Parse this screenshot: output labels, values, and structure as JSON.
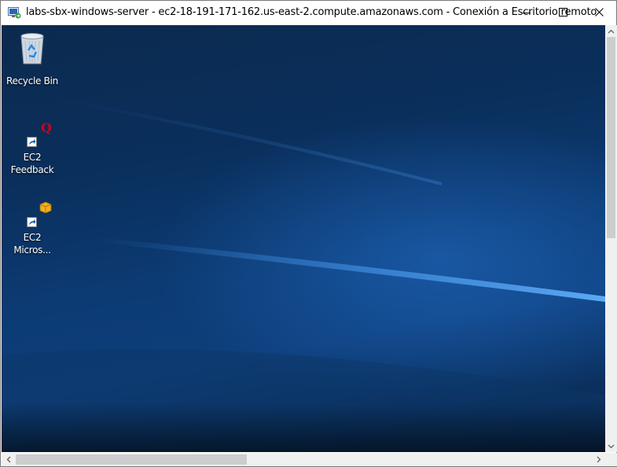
{
  "window": {
    "title": "labs-sbx-windows-server - ec2-18-191-171-162.us-east-2.compute.amazonaws.com - Conexión a Escritorio remoto",
    "app_icon": "remote-desktop-icon"
  },
  "titlebar_buttons": {
    "minimize": "minimize-icon",
    "maximize": "maximize-icon",
    "close": "close-icon"
  },
  "desktop": {
    "icons": [
      {
        "label": "Recycle Bin",
        "icon": "recycle-bin-icon"
      },
      {
        "label": "EC2\nFeedback",
        "icon": "feedback-q-icon",
        "shortcut": true
      },
      {
        "label": "EC2\nMicros...",
        "icon": "package-box-icon",
        "shortcut": true
      }
    ]
  },
  "colors": {
    "desktop_base": "#0a2f5c",
    "scrollbar_track": "#f0f0f0",
    "scrollbar_thumb": "#cdcdcd"
  }
}
